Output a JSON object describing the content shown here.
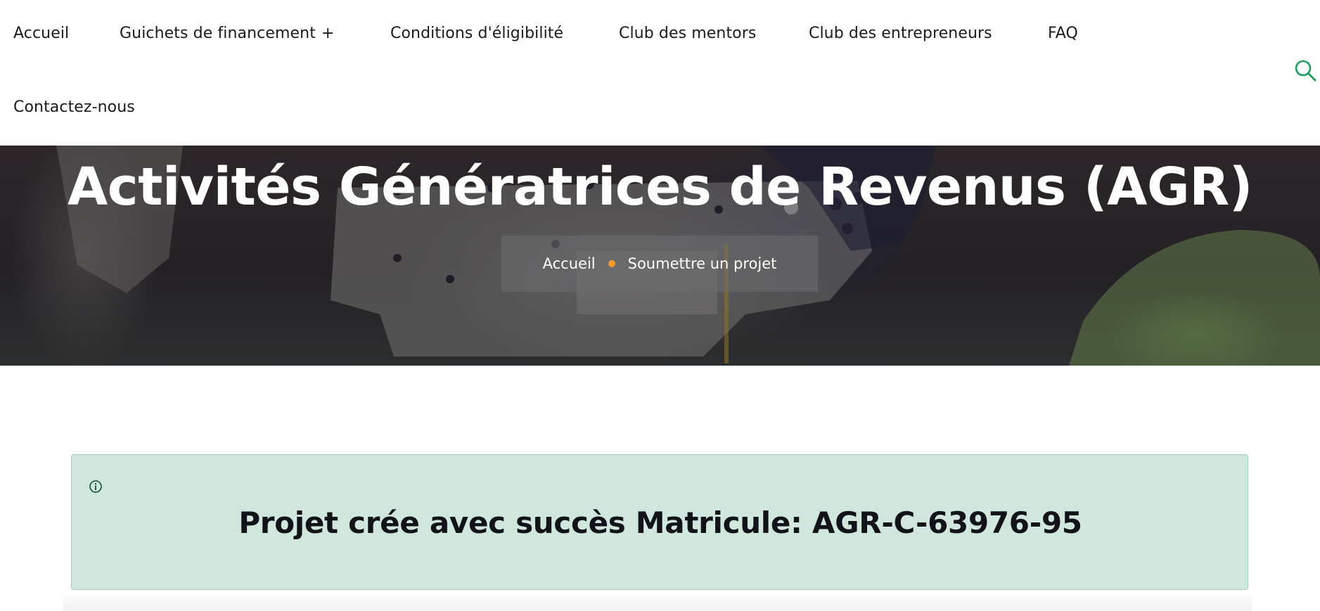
{
  "nav": {
    "items": [
      {
        "label": "Accueil"
      },
      {
        "label": "Guichets de financement",
        "suffix": "+"
      },
      {
        "label": "Conditions d'éligibilité"
      },
      {
        "label": "Club des mentors"
      },
      {
        "label": "Club des entrepreneurs"
      },
      {
        "label": "FAQ"
      },
      {
        "label": "Contactez-nous"
      }
    ],
    "search_icon": "search-icon"
  },
  "hero": {
    "title": "Activités Génératrices de Revenus (AGR)",
    "breadcrumb": {
      "home": "Accueil",
      "current": "Soumettre un projet",
      "separator_color": "#f29a2e"
    }
  },
  "alert": {
    "icon": "info-icon",
    "message": "Projet crée avec succès Matricule: AGR-C-63976-95",
    "background_color": "#d1e7dd"
  },
  "colors": {
    "accent": "#1aa05a",
    "breadcrumb_dot": "#f29a2e"
  }
}
